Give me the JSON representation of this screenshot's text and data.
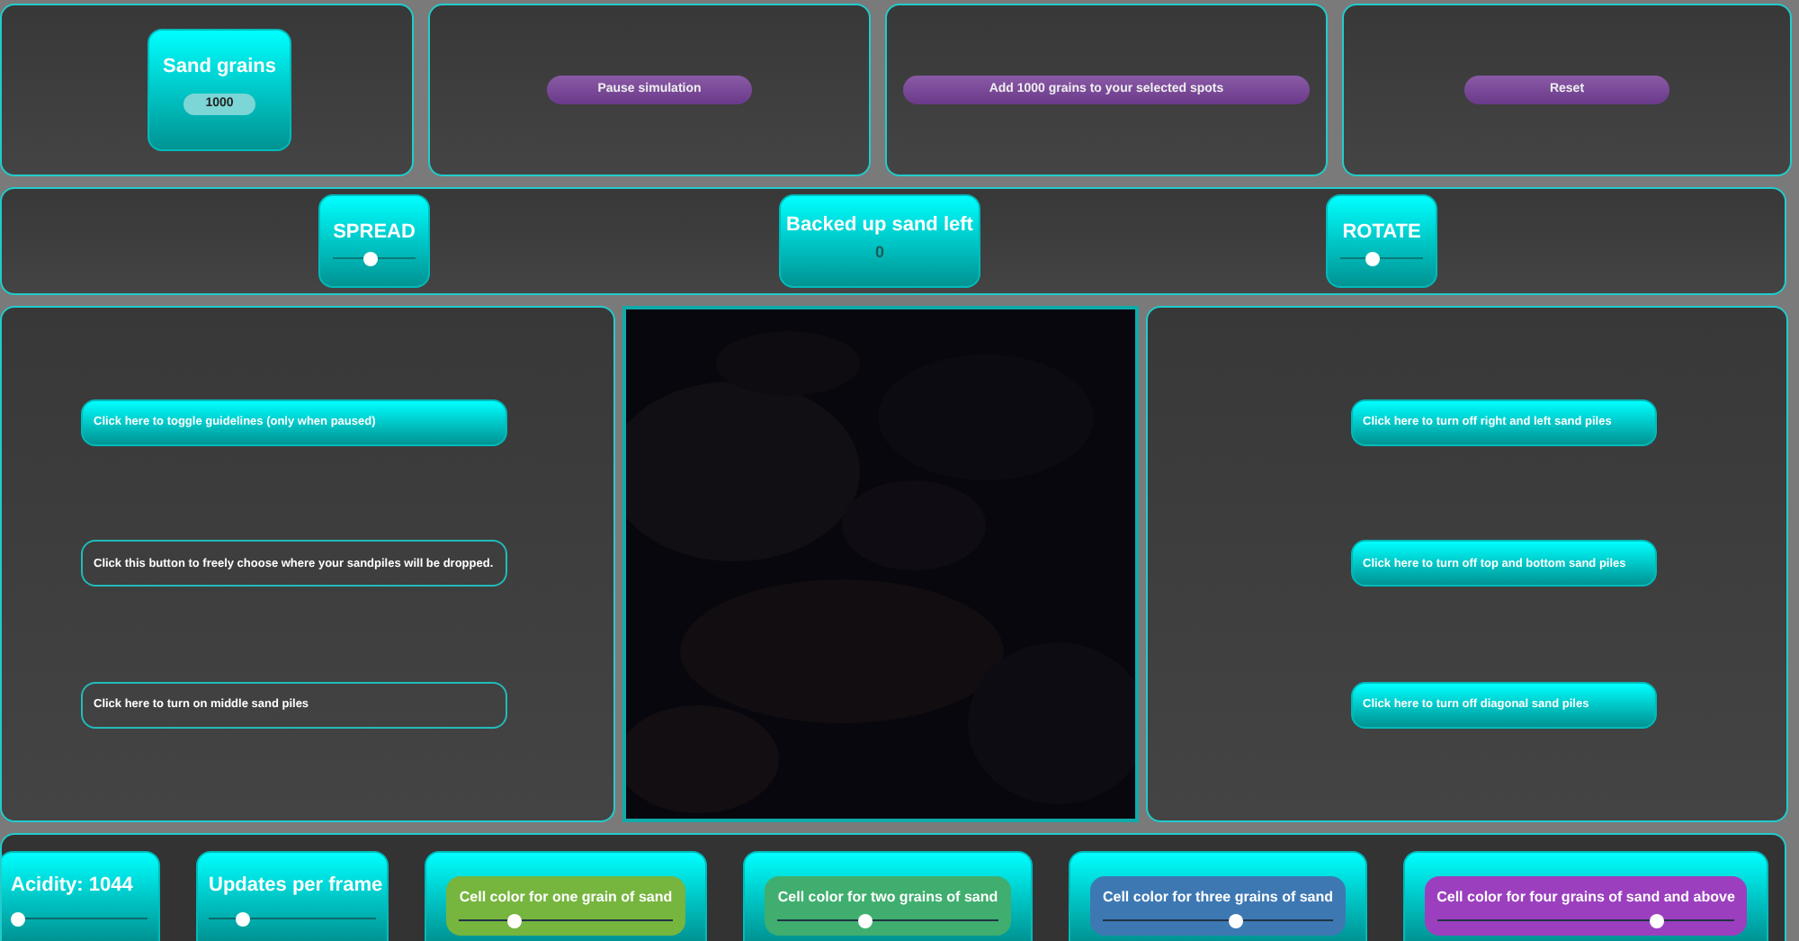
{
  "sand_grains": {
    "label": "Sand grains",
    "value": "1000"
  },
  "top_buttons": [
    {
      "label": "Pause simulation"
    },
    {
      "label": "Add 1000 grains to your selected spots"
    },
    {
      "label": "Reset"
    }
  ],
  "controls_row": [
    {
      "kind": "slider",
      "label": "SPREAD",
      "level": 0.45
    },
    {
      "kind": "reading",
      "label": "Backed up sand left",
      "value": "0"
    },
    {
      "kind": "slider",
      "label": "ROTATE",
      "level": 0.4
    }
  ],
  "left_buttons": [
    {
      "label": "Click here to toggle guidelines (only when paused)",
      "on": true
    },
    {
      "label": "Click this button to freely choose where your sandpiles will be dropped.",
      "on": false
    },
    {
      "label": "Click here to turn on middle sand piles",
      "on": false
    }
  ],
  "right_buttons": [
    {
      "label": "Click here to turn off right and left sand piles",
      "on": true
    },
    {
      "label": "Click here to turn off top and bottom sand piles",
      "on": true
    },
    {
      "label": "Click here to turn off diagonal sand piles",
      "on": true
    }
  ],
  "bottom_cards": [
    {
      "kind": "plain",
      "label": "Acidity: 1044",
      "level": 0.05
    },
    {
      "kind": "plain",
      "label": "Updates per frame",
      "level": 0.2
    },
    {
      "kind": "color",
      "label": "Cell color for one grain of sand",
      "color": "#76b53e",
      "level": 0.26
    },
    {
      "kind": "color",
      "label": "Cell color for two grains of sand",
      "color": "#3fae6e",
      "level": 0.4
    },
    {
      "kind": "color",
      "label": "Cell color for three grains of sand",
      "color": "#3d78b3",
      "level": 0.58
    },
    {
      "kind": "color",
      "label": "Cell color for four grains of sand and above",
      "color": "#9b3fbf",
      "level": 0.74
    }
  ]
}
